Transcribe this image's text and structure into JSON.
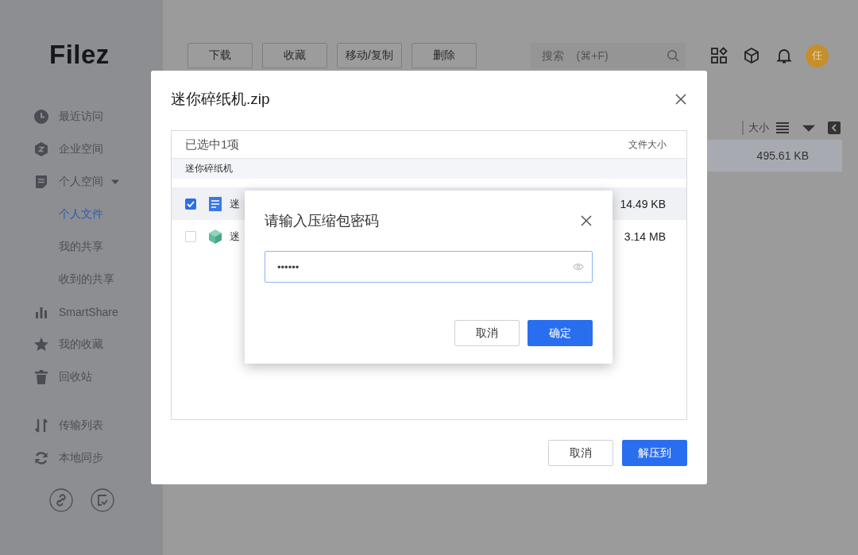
{
  "logo": "Filez",
  "sidebar": {
    "nav": [
      {
        "label": "最近访问",
        "selected": false
      },
      {
        "label": "企业空间",
        "selected": false
      },
      {
        "label": "个人空间",
        "selected": false,
        "expanded": true,
        "children": [
          {
            "label": "个人文件",
            "selected": true
          },
          {
            "label": "我的共享",
            "selected": false
          },
          {
            "label": "收到的共享",
            "selected": false
          }
        ]
      },
      {
        "label": "SmartShare",
        "selected": false
      },
      {
        "label": "我的收藏",
        "selected": false
      },
      {
        "label": "回收站",
        "selected": false
      }
    ],
    "tools": [
      {
        "label": "传输列表",
        "selected": false
      },
      {
        "label": "本地同步",
        "selected": false
      }
    ]
  },
  "toolbar": {
    "buttons": [
      "下载",
      "收藏",
      "移动/复制",
      "删除"
    ],
    "search": {
      "placeholder": "搜索    (⌘+F)"
    },
    "avatar": "任"
  },
  "file_list": {
    "column": "大小",
    "rows": [
      {
        "size": "495.61 KB",
        "selected": true
      }
    ]
  },
  "extract_dialog": {
    "title": "迷你碎纸机.zip",
    "summary": "已选中1项",
    "column": "文件大小",
    "path": "迷你碎纸机",
    "rows": [
      {
        "name": "迷",
        "size": "14.49 KB",
        "checked": true,
        "kind": "document"
      },
      {
        "name": "迷",
        "size": "3.14 MB",
        "checked": false,
        "kind": "package"
      }
    ],
    "buttons": [
      {
        "label": "取消",
        "primary": false
      },
      {
        "label": "解压到",
        "primary": true
      }
    ]
  },
  "password_dialog": {
    "title": "请输入压缩包密码",
    "value": "••••••",
    "buttons": [
      {
        "label": "取消",
        "primary": false
      },
      {
        "label": "确定",
        "primary": true
      }
    ]
  }
}
